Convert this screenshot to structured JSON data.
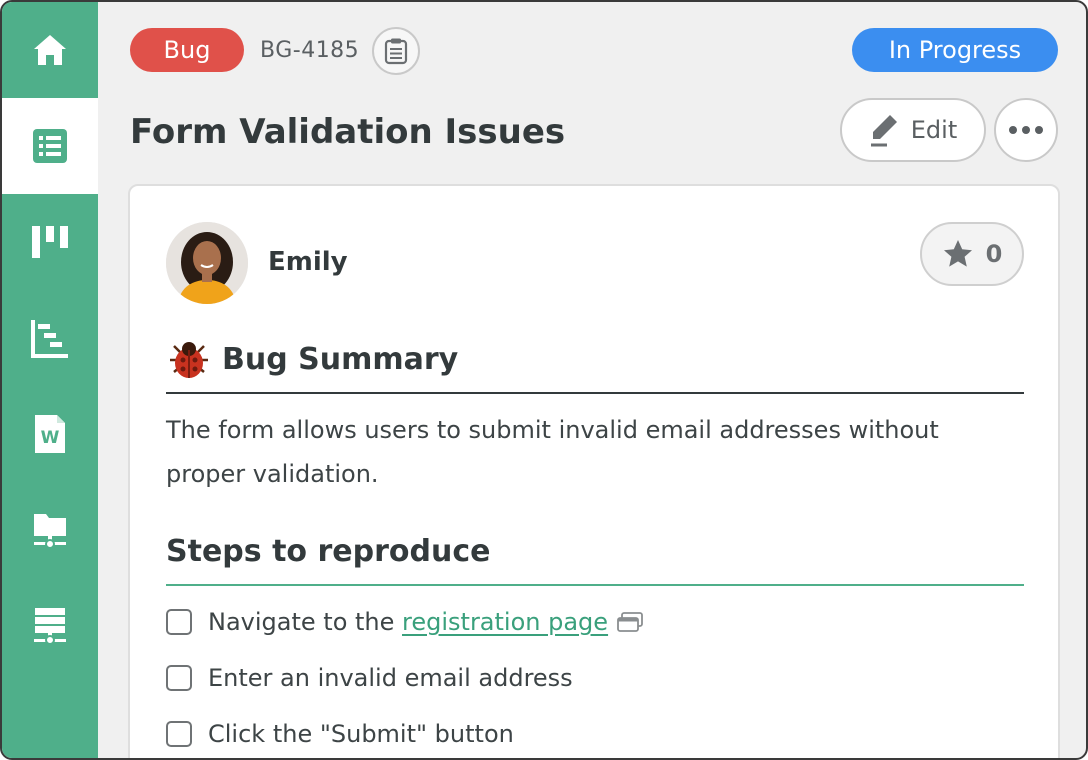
{
  "sidebar": {
    "items": [
      {
        "name": "home",
        "icon": "home-icon"
      },
      {
        "name": "list",
        "icon": "list-icon",
        "active": true
      },
      {
        "name": "board",
        "icon": "board-icon"
      },
      {
        "name": "gantt",
        "icon": "gantt-icon"
      },
      {
        "name": "word-doc",
        "icon": "word-document-icon"
      },
      {
        "name": "folder-network",
        "icon": "folder-network-icon"
      },
      {
        "name": "server",
        "icon": "server-icon"
      }
    ]
  },
  "header": {
    "type_badge": "Bug",
    "issue_id": "BG-4185",
    "status": "In Progress",
    "title": "Form Validation Issues",
    "edit_label": "Edit"
  },
  "card": {
    "author": "Emily",
    "star_count": "0",
    "summary_heading": "Bug Summary",
    "summary_text": "The form allows users to submit invalid email addresses without proper validation.",
    "steps_heading": "Steps to reproduce",
    "steps": [
      {
        "prefix": "Navigate to the ",
        "link": "registration page",
        "checked": false
      },
      {
        "text": "Enter an invalid email address",
        "checked": false
      },
      {
        "text": "Click the \"Submit\" button",
        "checked": false
      }
    ]
  },
  "colors": {
    "sidebar": "#4faf8a",
    "bug_badge": "#e0514a",
    "status_badge": "#3b8ef0",
    "link": "#3aa07c"
  }
}
